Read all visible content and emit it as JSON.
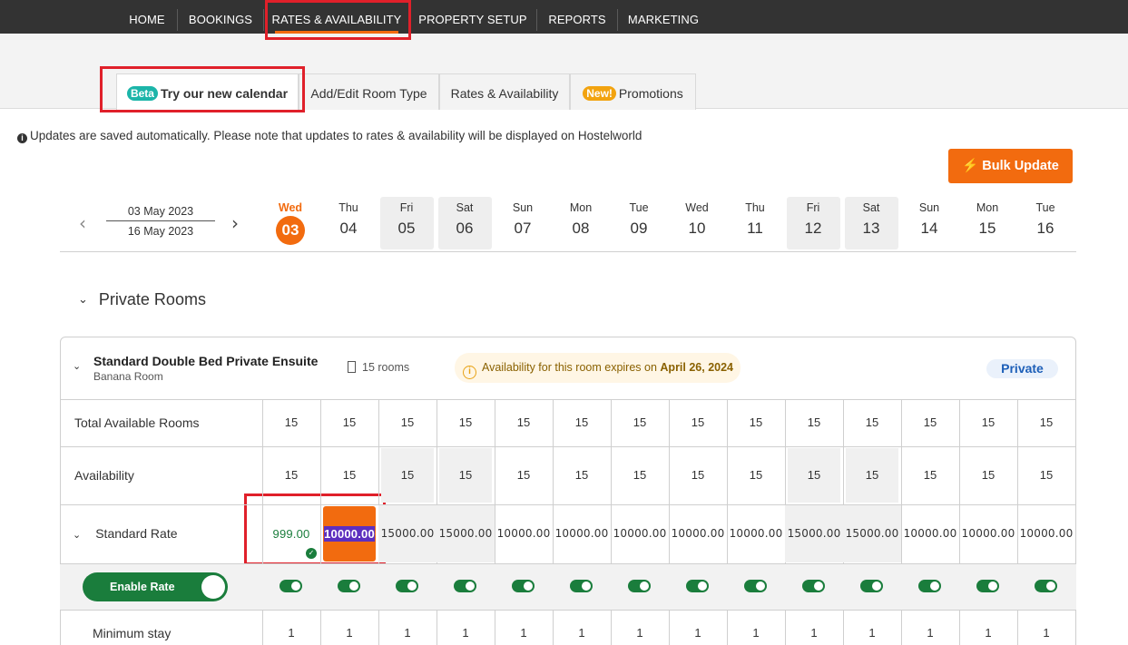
{
  "nav": {
    "items": [
      "HOME",
      "BOOKINGS",
      "RATES & AVAILABILITY",
      "PROPERTY SETUP",
      "REPORTS",
      "MARKETING"
    ],
    "active": "RATES & AVAILABILITY"
  },
  "tabs": {
    "beta_pill": "Beta",
    "calendar_label": "Try our new calendar",
    "room_type": "Add/Edit Room Type",
    "rates": "Rates & Availability",
    "new_pill": "New!",
    "promotions": "Promotions"
  },
  "info": {
    "icon": "info-icon",
    "text": "Updates are saved automatically. Please note that updates to rates & availability will be displayed on Hostelworld"
  },
  "bulk_update": {
    "label": "Bulk Update",
    "icon": "lightning-icon"
  },
  "date_range": {
    "start": "03 May 2023",
    "end": "16 May 2023"
  },
  "days": [
    {
      "name": "Wed",
      "num": "03"
    },
    {
      "name": "Thu",
      "num": "04"
    },
    {
      "name": "Fri",
      "num": "05"
    },
    {
      "name": "Sat",
      "num": "06"
    },
    {
      "name": "Sun",
      "num": "07"
    },
    {
      "name": "Mon",
      "num": "08"
    },
    {
      "name": "Tue",
      "num": "09"
    },
    {
      "name": "Wed",
      "num": "10"
    },
    {
      "name": "Thu",
      "num": "11"
    },
    {
      "name": "Fri",
      "num": "12"
    },
    {
      "name": "Sat",
      "num": "13"
    },
    {
      "name": "Sun",
      "num": "14"
    },
    {
      "name": "Mon",
      "num": "15"
    },
    {
      "name": "Tue",
      "num": "16"
    }
  ],
  "section": {
    "title": "Private Rooms"
  },
  "room": {
    "name": "Standard Double Bed Private Ensuite",
    "subtitle": "Banana Room",
    "rooms_count": "15 rooms",
    "expiry_prefix": "Availability for this room expires on",
    "expiry_date": "April 26, 2024",
    "type_badge": "Private"
  },
  "rows": {
    "total_label": "Total Available Rooms",
    "total_values": [
      "15",
      "15",
      "15",
      "15",
      "15",
      "15",
      "15",
      "15",
      "15",
      "15",
      "15",
      "15",
      "15",
      "15"
    ],
    "availability_label": "Availability",
    "availability_values": [
      "15",
      "15",
      "15",
      "15",
      "15",
      "15",
      "15",
      "15",
      "15",
      "15",
      "15",
      "15",
      "15",
      "15"
    ],
    "rate_label": "Standard Rate",
    "rate_values": [
      "999.00",
      "10000.00",
      "15000.00",
      "15000.00",
      "10000.00",
      "10000.00",
      "10000.00",
      "10000.00",
      "10000.00",
      "15000.00",
      "15000.00",
      "10000.00",
      "10000.00",
      "10000.00"
    ],
    "enable_label": "Enable Rate",
    "min_stay_label": "Minimum stay",
    "min_stay_values": [
      "1",
      "1",
      "1",
      "1",
      "1",
      "1",
      "1",
      "1",
      "1",
      "1",
      "1",
      "1",
      "1",
      "1"
    ]
  }
}
